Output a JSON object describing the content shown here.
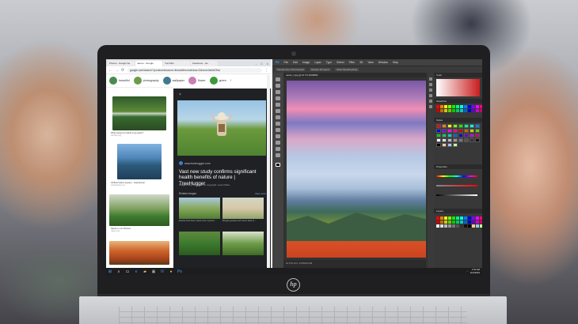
{
  "chrome": {
    "tabs": [
      {
        "label": "Photos - Google Se",
        "active": false
      },
      {
        "label": "nature - Google",
        "active": true
      },
      {
        "label": "YouTube",
        "active": false
      },
      {
        "label": "Facebook - Ho",
        "active": false
      }
    ],
    "window_controls": [
      "-",
      "□",
      "×"
    ],
    "url": "google.com/search?q=nature&source=lnms&tbm=isch&sa=X&ved=0ahUKEwi",
    "chips": [
      "beautiful",
      "photography",
      "wallpaper",
      "flower",
      "green"
    ],
    "results": [
      {
        "caption": "What causes an island to go green?",
        "source": "earthsky.org"
      },
      {
        "caption": "33 Best Nature Quotes - Inspirational",
        "source": "scholarsinfo.com"
      },
      {
        "caption": "Nature in our Pictures",
        "source": "nature.org"
      },
      {
        "caption": "",
        "source": ""
      }
    ],
    "panel": {
      "close": "×",
      "site": "www.treehugger.com",
      "title": "Vast new study confirms significant health benefits of nature | TreeHugger",
      "subtitle": "Images may be subject to copyright. Learn More",
      "related_label": "Related images",
      "view_more": "View more",
      "related": [
        {
          "caption": "Exactly how does 'nature time' improve ..."
        },
        {
          "caption": "Bringing people and nature back to..."
        },
        {
          "caption": ""
        },
        {
          "caption": ""
        }
      ]
    }
  },
  "photoshop": {
    "menu": [
      "PS",
      "File",
      "Edit",
      "Image",
      "Layer",
      "Type",
      "Select",
      "Filter",
      "3D",
      "View",
      "Window",
      "Help"
    ],
    "options": [
      "Sample Size: Point Sample",
      "Sample: All Layers",
      "Show Sampling Ring"
    ],
    "doc_tab": "nature_2.jpg @ 16.7% (RGB/8#)",
    "status": "16.67%   Doc: 24.9M/24.9M",
    "panels": {
      "color": "Color",
      "swatches": "Swatches",
      "styles": "Styles",
      "adjustments": "Properties",
      "layers": "Layers"
    },
    "swatch_colors": [
      "#ff0000",
      "#ff8000",
      "#ffff00",
      "#80ff00",
      "#00ff00",
      "#00ff80",
      "#00ffff",
      "#0080ff",
      "#0000ff",
      "#8000ff",
      "#ff00ff",
      "#ff0080",
      "#cc0000",
      "#cc6600",
      "#cccc00",
      "#66cc00",
      "#00cc00",
      "#00cc66",
      "#00cccc",
      "#0066cc",
      "#0000cc",
      "#6600cc",
      "#cc00cc",
      "#cc0066",
      "#ffffff",
      "#dddddd",
      "#bbbbbb",
      "#999999",
      "#777777",
      "#555555",
      "#333333",
      "#111111",
      "#000000",
      "#ffcc99",
      "#99ccff",
      "#ccff99"
    ]
  },
  "taskbar": {
    "icons": [
      "windows-icon",
      "search-icon",
      "task-view-icon",
      "edge-icon",
      "explorer-icon",
      "store-icon",
      "word-icon",
      "chrome-icon",
      "photoshop-icon"
    ],
    "time": "1:51 AM",
    "date": "11/4/2019"
  }
}
